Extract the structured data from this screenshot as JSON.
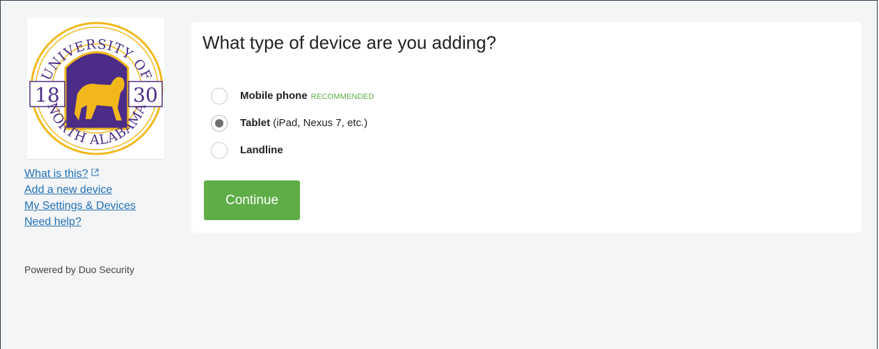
{
  "question": "What type of device are you adding?",
  "logo": {
    "top_text": "UNIVERSITY OF",
    "bottom_text": "NORTH ALABAMA",
    "year_left": "18",
    "year_right": "30"
  },
  "options": [
    {
      "label": "Mobile phone",
      "detail": "",
      "badge": "RECOMMENDED",
      "checked": false
    },
    {
      "label": "Tablet",
      "detail": "(iPad, Nexus 7, etc.)",
      "badge": "",
      "checked": true
    },
    {
      "label": "Landline",
      "detail": "",
      "badge": "",
      "checked": false
    }
  ],
  "continue_label": "Continue",
  "sidebar": {
    "links": [
      {
        "label": "What is this?",
        "icon": "external-link-icon"
      },
      {
        "label": "Add a new device"
      },
      {
        "label": "My Settings & Devices"
      },
      {
        "label": "Need help?"
      }
    ],
    "powered_by": "Powered by Duo Security"
  },
  "colors": {
    "link": "#1f6fb6",
    "accent_green": "#5ead47",
    "frame_border": "#2f3b4c",
    "logo_purple": "#4b2c87",
    "logo_gold": "#f2b81b"
  }
}
